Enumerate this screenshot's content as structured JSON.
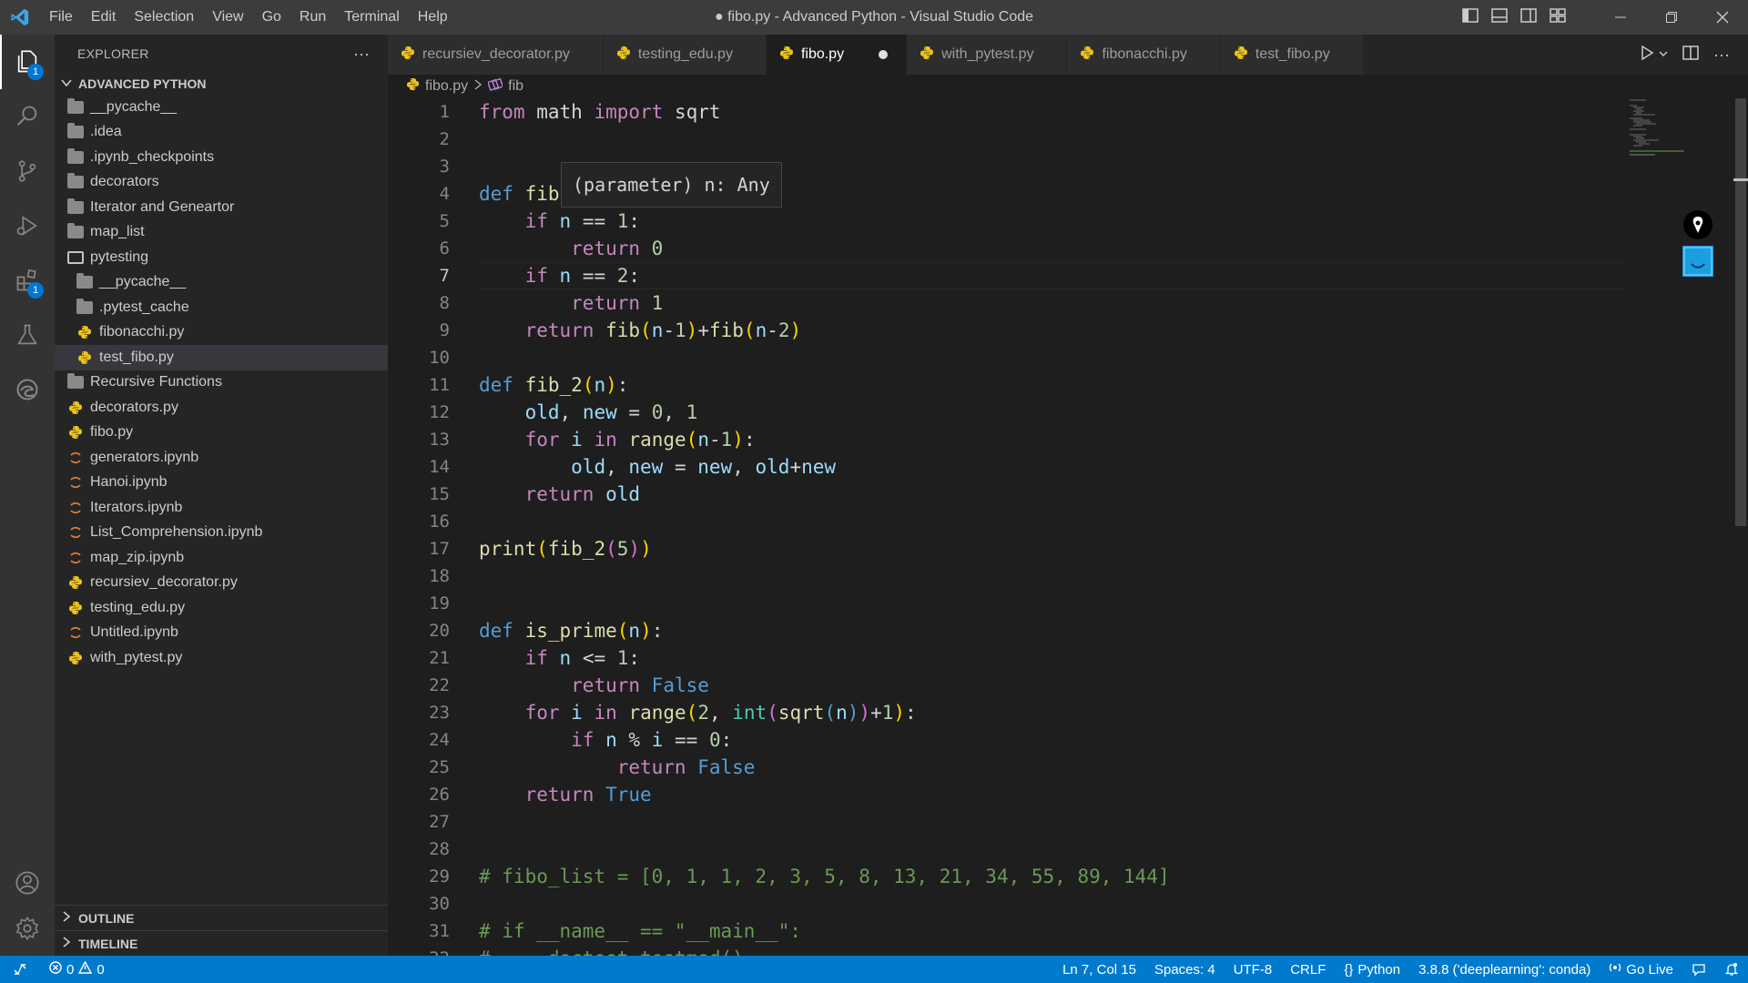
{
  "window": {
    "title": "● fibo.py - Advanced Python - Visual Studio Code",
    "menu": [
      "File",
      "Edit",
      "Selection",
      "View",
      "Go",
      "Run",
      "Terminal",
      "Help"
    ]
  },
  "activity_bar": {
    "explorer_badge": "1",
    "extensions_badge": "1"
  },
  "sidebar": {
    "title": "EXPLORER",
    "more": "···",
    "folder": "ADVANCED PYTHON",
    "items": [
      {
        "label": "__pycache__",
        "type": "folder",
        "depth": 0
      },
      {
        "label": ".idea",
        "type": "folder",
        "depth": 0
      },
      {
        "label": ".ipynb_checkpoints",
        "type": "folder",
        "depth": 0
      },
      {
        "label": "decorators",
        "type": "folder",
        "depth": 0
      },
      {
        "label": "Iterator and Geneartor",
        "type": "folder",
        "depth": 0
      },
      {
        "label": "map_list",
        "type": "folder",
        "depth": 0
      },
      {
        "label": "pytesting",
        "type": "folder-open",
        "depth": 0
      },
      {
        "label": "__pycache__",
        "type": "folder",
        "depth": 1
      },
      {
        "label": ".pytest_cache",
        "type": "folder",
        "depth": 1
      },
      {
        "label": "fibonacchi.py",
        "type": "python",
        "depth": 1
      },
      {
        "label": "test_fibo.py",
        "type": "python",
        "depth": 1,
        "selected": true
      },
      {
        "label": "Recursive Functions",
        "type": "folder",
        "depth": 0
      },
      {
        "label": "decorators.py",
        "type": "python",
        "depth": 0
      },
      {
        "label": "fibo.py",
        "type": "python",
        "depth": 0
      },
      {
        "label": "generators.ipynb",
        "type": "notebook",
        "depth": 0
      },
      {
        "label": "Hanoi.ipynb",
        "type": "notebook",
        "depth": 0
      },
      {
        "label": "Iterators.ipynb",
        "type": "notebook",
        "depth": 0
      },
      {
        "label": "List_Comprehension.ipynb",
        "type": "notebook",
        "depth": 0
      },
      {
        "label": "map_zip.ipynb",
        "type": "notebook",
        "depth": 0
      },
      {
        "label": "recursiev_decorator.py",
        "type": "python",
        "depth": 0
      },
      {
        "label": "testing_edu.py",
        "type": "python",
        "depth": 0
      },
      {
        "label": "Untitled.ipynb",
        "type": "notebook",
        "depth": 0
      },
      {
        "label": "with_pytest.py",
        "type": "python",
        "depth": 0
      }
    ],
    "outline": "OUTLINE",
    "timeline": "TIMELINE"
  },
  "tabs": [
    {
      "label": "recursiev_decorator.py",
      "active": false
    },
    {
      "label": "testing_edu.py",
      "active": false
    },
    {
      "label": "fibo.py",
      "active": true,
      "dirty": true
    },
    {
      "label": "with_pytest.py",
      "active": false
    },
    {
      "label": "fibonacchi.py",
      "active": false
    },
    {
      "label": "test_fibo.py",
      "active": false
    }
  ],
  "breadcrumb": {
    "file": "fibo.py",
    "symbol": "fib"
  },
  "editor": {
    "current_line": 7,
    "hover": "(parameter) n: Any",
    "lines": [
      [
        [
          "from",
          "kw"
        ],
        [
          " math ",
          "op"
        ],
        [
          "import",
          "kw"
        ],
        [
          " sqrt",
          "op"
        ]
      ],
      [],
      [],
      [
        [
          "def",
          "def"
        ],
        [
          " ",
          "op"
        ],
        [
          "fib",
          "fn"
        ]
      ],
      [
        [
          "    ",
          "op"
        ],
        [
          "if",
          "kw"
        ],
        [
          " ",
          "op"
        ],
        [
          "n",
          "var"
        ],
        [
          " == ",
          "op"
        ],
        [
          "1",
          "num"
        ],
        [
          ":",
          "op"
        ]
      ],
      [
        [
          "        ",
          "op"
        ],
        [
          "return",
          "kw"
        ],
        [
          " ",
          "op"
        ],
        [
          "0",
          "num"
        ]
      ],
      [
        [
          "    ",
          "op"
        ],
        [
          "if",
          "kw"
        ],
        [
          " ",
          "op"
        ],
        [
          "n",
          "var"
        ],
        [
          " == ",
          "op"
        ],
        [
          "2",
          "num"
        ],
        [
          ":",
          "op"
        ]
      ],
      [
        [
          "        ",
          "op"
        ],
        [
          "return",
          "kw"
        ],
        [
          " ",
          "op"
        ],
        [
          "1",
          "num"
        ]
      ],
      [
        [
          "    ",
          "op"
        ],
        [
          "return",
          "kw"
        ],
        [
          " ",
          "op"
        ],
        [
          "fib",
          "fn"
        ],
        [
          "(",
          "b1"
        ],
        [
          "n",
          "var"
        ],
        [
          "-",
          "op"
        ],
        [
          "1",
          "num"
        ],
        [
          ")",
          "b1"
        ],
        [
          "+",
          "op"
        ],
        [
          "fib",
          "fn"
        ],
        [
          "(",
          "b1"
        ],
        [
          "n",
          "var"
        ],
        [
          "-",
          "op"
        ],
        [
          "2",
          "num"
        ],
        [
          ")",
          "b1"
        ]
      ],
      [],
      [
        [
          "def",
          "def"
        ],
        [
          " ",
          "op"
        ],
        [
          "fib_2",
          "fn"
        ],
        [
          "(",
          "b1"
        ],
        [
          "n",
          "var"
        ],
        [
          ")",
          "b1"
        ],
        [
          ":",
          "op"
        ]
      ],
      [
        [
          "    ",
          "op"
        ],
        [
          "old",
          "var"
        ],
        [
          ", ",
          "op"
        ],
        [
          "new",
          "var"
        ],
        [
          " = ",
          "op"
        ],
        [
          "0",
          "num"
        ],
        [
          ", ",
          "op"
        ],
        [
          "1",
          "num"
        ]
      ],
      [
        [
          "    ",
          "op"
        ],
        [
          "for",
          "kw"
        ],
        [
          " ",
          "op"
        ],
        [
          "i",
          "var"
        ],
        [
          " ",
          "op"
        ],
        [
          "in",
          "kw"
        ],
        [
          " ",
          "op"
        ],
        [
          "range",
          "fn"
        ],
        [
          "(",
          "b1"
        ],
        [
          "n",
          "var"
        ],
        [
          "-",
          "op"
        ],
        [
          "1",
          "num"
        ],
        [
          ")",
          "b1"
        ],
        [
          ":",
          "op"
        ]
      ],
      [
        [
          "        ",
          "op"
        ],
        [
          "old",
          "var"
        ],
        [
          ", ",
          "op"
        ],
        [
          "new",
          "var"
        ],
        [
          " = ",
          "op"
        ],
        [
          "new",
          "var"
        ],
        [
          ", ",
          "op"
        ],
        [
          "old",
          "var"
        ],
        [
          "+",
          "op"
        ],
        [
          "new",
          "var"
        ]
      ],
      [
        [
          "    ",
          "op"
        ],
        [
          "return",
          "kw"
        ],
        [
          " ",
          "op"
        ],
        [
          "old",
          "var"
        ]
      ],
      [],
      [
        [
          "print",
          "fn"
        ],
        [
          "(",
          "b1"
        ],
        [
          "fib_2",
          "fn"
        ],
        [
          "(",
          "b2"
        ],
        [
          "5",
          "num"
        ],
        [
          ")",
          "b2"
        ],
        [
          ")",
          "b1"
        ]
      ],
      [],
      [],
      [
        [
          "def",
          "def"
        ],
        [
          " ",
          "op"
        ],
        [
          "is_prime",
          "fn"
        ],
        [
          "(",
          "b1"
        ],
        [
          "n",
          "var"
        ],
        [
          ")",
          "b1"
        ],
        [
          ":",
          "op"
        ]
      ],
      [
        [
          "    ",
          "op"
        ],
        [
          "if",
          "kw"
        ],
        [
          " ",
          "op"
        ],
        [
          "n",
          "var"
        ],
        [
          " <= ",
          "op"
        ],
        [
          "1",
          "num"
        ],
        [
          ":",
          "op"
        ]
      ],
      [
        [
          "        ",
          "op"
        ],
        [
          "return",
          "kw"
        ],
        [
          " ",
          "op"
        ],
        [
          "False",
          "kc"
        ]
      ],
      [
        [
          "    ",
          "op"
        ],
        [
          "for",
          "kw"
        ],
        [
          " ",
          "op"
        ],
        [
          "i",
          "var"
        ],
        [
          " ",
          "op"
        ],
        [
          "in",
          "kw"
        ],
        [
          " ",
          "op"
        ],
        [
          "range",
          "fn"
        ],
        [
          "(",
          "b1"
        ],
        [
          "2",
          "num"
        ],
        [
          ", ",
          "op"
        ],
        [
          "int",
          "bi"
        ],
        [
          "(",
          "b2"
        ],
        [
          "sqrt",
          "fn"
        ],
        [
          "(",
          "def"
        ],
        [
          "n",
          "var"
        ],
        [
          ")",
          "def"
        ],
        [
          ")",
          "b2"
        ],
        [
          "+",
          "op"
        ],
        [
          "1",
          "num"
        ],
        [
          ")",
          "b1"
        ],
        [
          ":",
          "op"
        ]
      ],
      [
        [
          "        ",
          "op"
        ],
        [
          "if",
          "kw"
        ],
        [
          " ",
          "op"
        ],
        [
          "n",
          "var"
        ],
        [
          " % ",
          "op"
        ],
        [
          "i",
          "var"
        ],
        [
          " == ",
          "op"
        ],
        [
          "0",
          "num"
        ],
        [
          ":",
          "op"
        ]
      ],
      [
        [
          "            ",
          "op"
        ],
        [
          "return",
          "kw"
        ],
        [
          " ",
          "op"
        ],
        [
          "False",
          "kc"
        ]
      ],
      [
        [
          "    ",
          "op"
        ],
        [
          "return",
          "kw"
        ],
        [
          " ",
          "op"
        ],
        [
          "True",
          "kc"
        ]
      ],
      [],
      [],
      [
        [
          "# fibo_list = [0, 1, 1, 2, 3, 5, 8, 13, 21, 34, 55, 89, 144]",
          "cmt"
        ]
      ],
      [],
      [
        [
          "# if __name__ == \"__main__\":",
          "cmt"
        ]
      ],
      [
        [
          "#     doctest.testmod()",
          "cmt"
        ]
      ]
    ]
  },
  "statusbar": {
    "errors": "0",
    "warnings": "0",
    "position": "Ln 7, Col 15",
    "spaces": "Spaces: 4",
    "encoding": "UTF-8",
    "eol": "CRLF",
    "language": "Python",
    "interpreter": "3.8.8 ('deeplearning': conda)",
    "go_live": "Go Live"
  },
  "colors": {
    "statusbar": "#007acc",
    "activity_bar": "#333333",
    "sidebar": "#252526",
    "editor": "#1e1e1e",
    "python_icon": "#f0c419"
  }
}
